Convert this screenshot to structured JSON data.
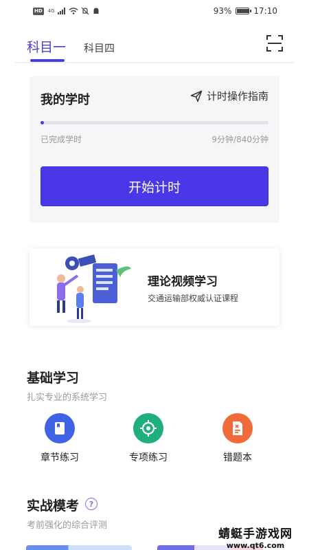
{
  "status_bar": {
    "hd": "HD",
    "signal": "4G",
    "battery_text": "93%",
    "battery_level": 0.93,
    "time": "17:10"
  },
  "tabs": {
    "active": "科目一",
    "inactive": "科目四",
    "scan_icon": "scan-icon"
  },
  "study_time": {
    "title": "我的学时",
    "guide_label": "计时操作指南",
    "done_label": "已完成学时",
    "minutes": "9分钟/840分钟",
    "progress": 0.0107,
    "start_button": "开始计时",
    "accent": "#4a38e8"
  },
  "video": {
    "title": "理论视频学习",
    "subtitle": "交通运输部权威认证课程"
  },
  "basic": {
    "title": "基础学习",
    "subtitle": "扎实专业的系统学习",
    "items": [
      {
        "label": "章节练习",
        "icon": "book-icon",
        "color": "#3f63e3"
      },
      {
        "label": "专项练习",
        "icon": "target-icon",
        "color": "#1fae7f"
      },
      {
        "label": "错题本",
        "icon": "error-doc-icon",
        "color": "#f06a3a"
      }
    ]
  },
  "exam": {
    "title": "实战模考",
    "help": "?",
    "subtitle": "考前强化的综合评测"
  },
  "watermark": {
    "main": "蜻蜓手游戏网",
    "url": "www.qt6.com"
  }
}
